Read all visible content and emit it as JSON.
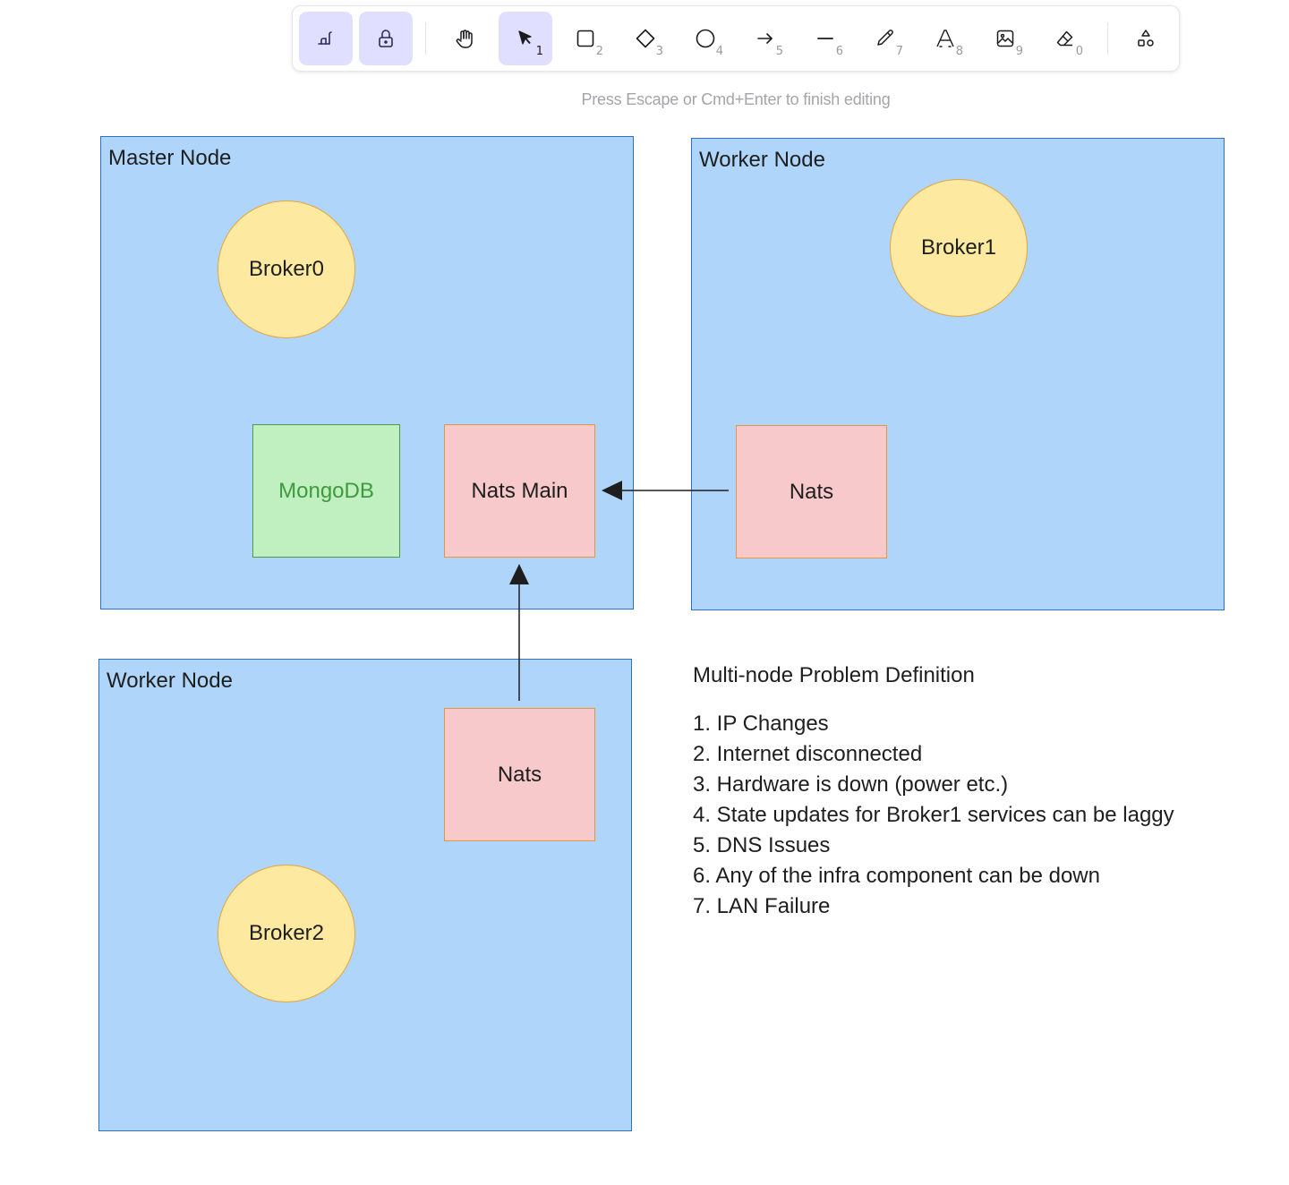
{
  "toolbar": {
    "tools": [
      {
        "name": "keep-tool-active",
        "icon": "keep-active-icon",
        "key": ""
      },
      {
        "name": "lock",
        "icon": "lock-icon",
        "key": ""
      },
      {
        "name": "hand",
        "icon": "hand-icon",
        "key": ""
      },
      {
        "name": "selection",
        "icon": "pointer-icon",
        "key": "1"
      },
      {
        "name": "rectangle",
        "icon": "rectangle-icon",
        "key": "2"
      },
      {
        "name": "diamond",
        "icon": "diamond-icon",
        "key": "3"
      },
      {
        "name": "ellipse",
        "icon": "ellipse-icon",
        "key": "4"
      },
      {
        "name": "arrow",
        "icon": "arrow-icon",
        "key": "5"
      },
      {
        "name": "line",
        "icon": "line-icon",
        "key": "6"
      },
      {
        "name": "draw",
        "icon": "pencil-icon",
        "key": "7"
      },
      {
        "name": "text",
        "icon": "text-icon",
        "key": "8"
      },
      {
        "name": "image",
        "icon": "image-icon",
        "key": "9"
      },
      {
        "name": "eraser",
        "icon": "eraser-icon",
        "key": "0"
      },
      {
        "name": "more-shapes",
        "icon": "shapes-icon",
        "key": ""
      }
    ],
    "selected_tool": "selection"
  },
  "hint": "Press Escape or Cmd+Enter to finish editing",
  "diagram": {
    "master_node": {
      "title": "Master Node",
      "broker": "Broker0",
      "database": "MongoDB",
      "nats": "Nats Main"
    },
    "worker_node_right": {
      "title": "Worker Node",
      "broker": "Broker1",
      "nats": "Nats"
    },
    "worker_node_bottom": {
      "title": "Worker Node",
      "broker": "Broker2",
      "nats": "Nats"
    }
  },
  "definition": {
    "title": "Multi-node Problem Definition",
    "items": [
      "1. IP Changes",
      "2. Internet disconnected",
      "3. Hardware is down (power etc.)",
      "4. State updates for Broker1 services can be laggy",
      "5. DNS Issues",
      "6. Any of the infra component can be down",
      "7. LAN Failure"
    ]
  },
  "colors": {
    "node_fill": "#afd5fa",
    "node_stroke": "#2e6fc7",
    "broker_fill": "#fdeaa0",
    "broker_stroke": "#e5a63a",
    "nats_fill": "#f7c9cb",
    "nats_stroke": "#e8963b",
    "mongo_fill": "#c0f0c0",
    "mongo_stroke": "#4a9a4a",
    "toolbar_active": "#e0dfff"
  }
}
